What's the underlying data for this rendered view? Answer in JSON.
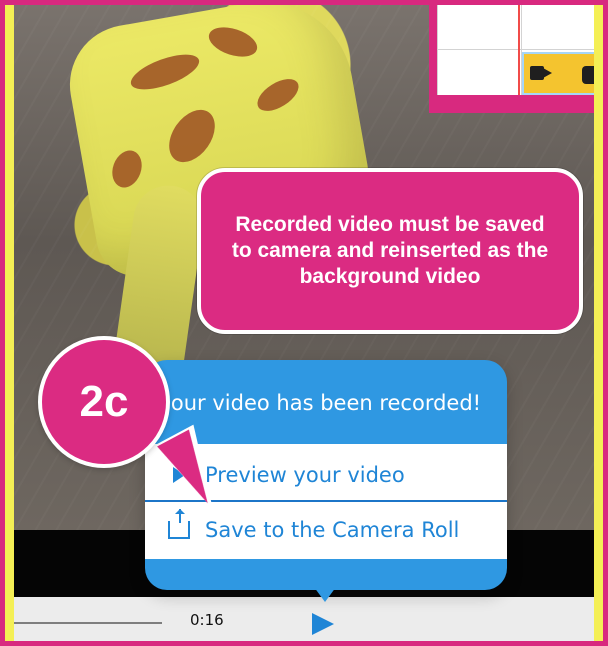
{
  "overlay": {
    "instruction": "Recorded video must be saved to camera and reinserted as the background video",
    "step_badge": "2c"
  },
  "popup": {
    "title": "our video has been recorded!",
    "menu": [
      {
        "label": "Preview your video",
        "icon": "play-icon"
      },
      {
        "label": "Save to the Camera Roll",
        "icon": "share-icon"
      }
    ]
  },
  "player": {
    "time": "0:16",
    "play_icon": "play-icon"
  },
  "inset": {
    "camera_icon": "camera-icon"
  },
  "colors": {
    "accent": "#db2b82",
    "popup_blue": "#2f98e2",
    "text_blue": "#1f85d6",
    "yellow": "#f4ef55"
  }
}
